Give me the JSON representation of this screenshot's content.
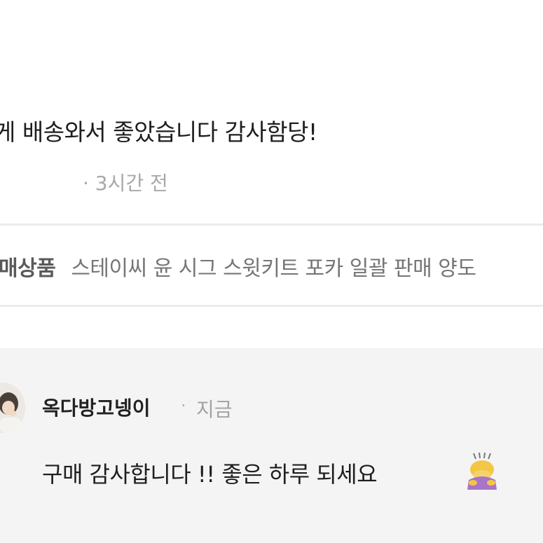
{
  "review": {
    "text": "게 배송와서 좋았습니다 감사함당!",
    "time": "· 3시간 전"
  },
  "product": {
    "label": "매상품",
    "name": "스테이씨 윤 시그 스윗키트 포카 일괄 판매 양도"
  },
  "reply": {
    "author": "옥다방고넹이",
    "dot": "·",
    "time": "지금",
    "text": "구매 감사합니다 !! 좋은 하루 되세요",
    "emoji_icon": "person-bowing-icon"
  },
  "colors": {
    "divider": "#ebebeb",
    "reply_background": "#f4f4f4",
    "muted_text": "#a8a8a8"
  }
}
